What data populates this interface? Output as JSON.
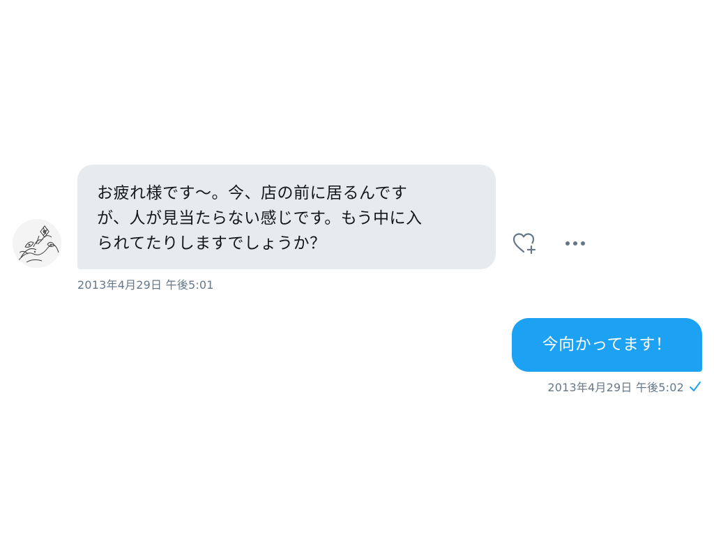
{
  "conversation": {
    "incoming": {
      "avatar_icon": "flower-sketch-avatar",
      "lines": [
        "お疲れ様です〜。今、店の前に居るんです",
        "が、人が見当たらない感じです。もう中に入",
        "られてたりしますでしょうか？"
      ],
      "timestamp": "2013年4月29日 午後5:01",
      "bubble_color": "#e8ebee",
      "actions": {
        "like_icon": "heart-plus-icon",
        "more_icon": "ellipsis-icon"
      }
    },
    "outgoing": {
      "text": "今向かってます！",
      "timestamp": "2013年4月29日 午後5:02",
      "status_icon": "checkmark-icon",
      "bubble_color": "#1da1f2"
    }
  },
  "colors": {
    "accent": "#1da1f2",
    "meta_text": "#65778a",
    "icon_gray": "#657786"
  }
}
